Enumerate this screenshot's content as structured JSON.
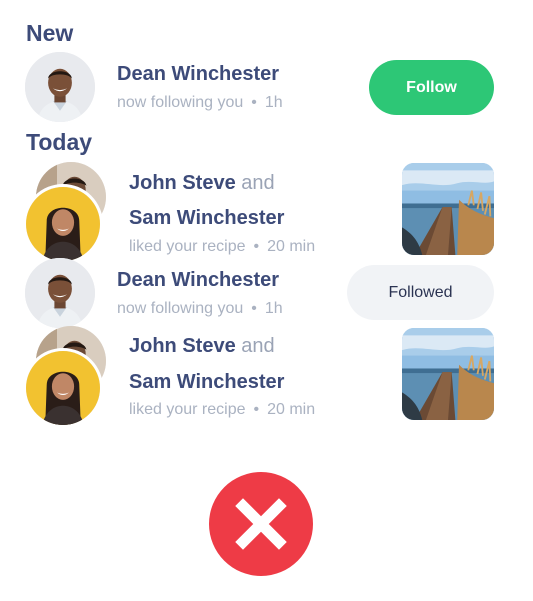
{
  "sections": [
    {
      "heading": "New"
    },
    {
      "heading": "Today"
    }
  ],
  "notifications": [
    {
      "type": "follow",
      "user": "Dean Winchester",
      "action": "now following you",
      "time": "1h",
      "button_label": "Follow"
    },
    {
      "type": "like",
      "user_a": "John Steve",
      "connector": "and",
      "user_b": "Sam Winchester",
      "action": "liked your recipe",
      "time": "20 min"
    },
    {
      "type": "follow",
      "user": "Dean Winchester",
      "action": "now following you",
      "time": "1h",
      "button_label": "Followed"
    },
    {
      "type": "like",
      "user_a": "John Steve",
      "connector": "and",
      "user_b": "Sam Winchester",
      "action": "liked your recipe",
      "time": "20 min"
    }
  ],
  "separator": "•",
  "colors": {
    "heading": "#3d4b79",
    "meta": "#aab2c1",
    "follow_button": "#2dc776",
    "followed_button": "#f1f3f6",
    "close_button": "#ee3b46"
  },
  "icons": {
    "close": "close-icon"
  }
}
